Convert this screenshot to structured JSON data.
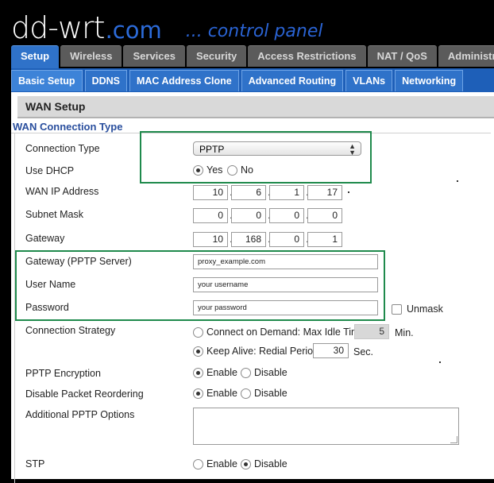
{
  "header": {
    "logo_main": "dd-wrt",
    "logo_dotcom": ".com",
    "logo_tagline": "... control panel"
  },
  "tabs": [
    {
      "label": "Setup",
      "active": true
    },
    {
      "label": "Wireless"
    },
    {
      "label": "Services"
    },
    {
      "label": "Security"
    },
    {
      "label": "Access Restrictions"
    },
    {
      "label": "NAT / QoS"
    },
    {
      "label": "Administrati"
    }
  ],
  "subtabs": [
    {
      "label": "Basic Setup",
      "active": true
    },
    {
      "label": "DDNS"
    },
    {
      "label": "MAC Address Clone"
    },
    {
      "label": "Advanced Routing"
    },
    {
      "label": "VLANs"
    },
    {
      "label": "Networking"
    }
  ],
  "section": {
    "title": "WAN Setup",
    "legend": "WAN Connection Type"
  },
  "fields": {
    "connection_type": {
      "label": "Connection Type",
      "value": "PPTP"
    },
    "use_dhcp": {
      "label": "Use DHCP",
      "yes": "Yes",
      "no": "No",
      "selected": "Yes"
    },
    "wan_ip": {
      "label": "WAN IP Address",
      "octets": [
        "10",
        "6",
        "1",
        "17"
      ]
    },
    "subnet_mask": {
      "label": "Subnet Mask",
      "octets": [
        "0",
        "0",
        "0",
        "0"
      ]
    },
    "gateway": {
      "label": "Gateway",
      "octets": [
        "10",
        "168",
        "0",
        "1"
      ]
    },
    "pptp_server": {
      "label": "Gateway (PPTP Server)",
      "value": "proxy_example.com"
    },
    "username": {
      "label": "User Name",
      "value": "your username"
    },
    "password": {
      "label": "Password",
      "value": "your password",
      "unmask": "Unmask"
    },
    "strategy": {
      "label": "Connection Strategy",
      "on_demand": "Connect on Demand: Max Idle Time",
      "idle_value": "5",
      "idle_unit": "Min.",
      "keep_alive": "Keep Alive: Redial Period",
      "redial_value": "30",
      "redial_unit": "Sec.",
      "selected": "Keep Alive"
    },
    "pptp_encryption": {
      "label": "PPTP Encryption",
      "enable": "Enable",
      "disable": "Disable",
      "selected": "Enable"
    },
    "packet_reorder": {
      "label": "Disable Packet Reordering",
      "enable": "Enable",
      "disable": "Disable",
      "selected": "Enable"
    },
    "additional_options": {
      "label": "Additional PPTP Options",
      "value": ""
    },
    "stp": {
      "label": "STP",
      "enable": "Enable",
      "disable": "Disable",
      "selected": "Disable"
    }
  },
  "colors": {
    "accent": "#2f72c9",
    "highlight": "#1f8a4c"
  }
}
